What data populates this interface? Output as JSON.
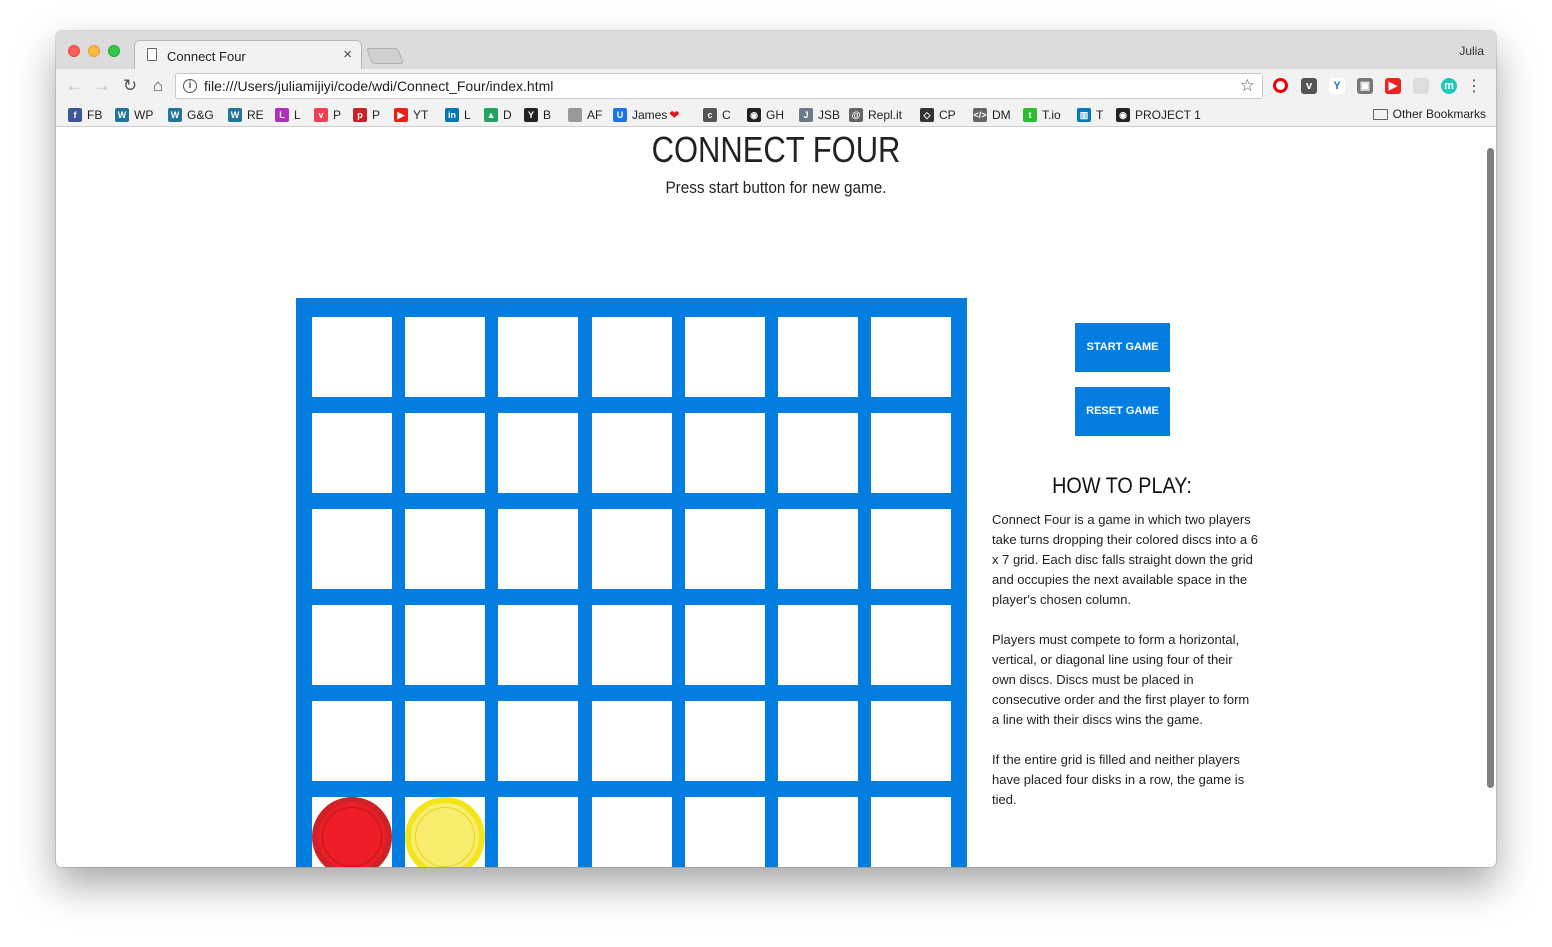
{
  "browser": {
    "tab_title": "Connect Four",
    "tab_close": "×",
    "profile_name": "Julia",
    "url": "file:///Users/juliamijiyi/code/wdi/Connect_Four/index.html",
    "nav": {
      "back": "←",
      "forward": "→",
      "reload": "↻",
      "home": "⌂"
    },
    "menu": "⋮",
    "star": "☆"
  },
  "bookmarks": [
    {
      "label": "FB",
      "icon": "facebook-icon",
      "color": "#3b5998",
      "glyph": "f"
    },
    {
      "label": "WP",
      "icon": "wordpress-icon",
      "color": "#21759b",
      "glyph": "W"
    },
    {
      "label": "G&G",
      "icon": "wordpress-icon",
      "color": "#21759b",
      "glyph": "W"
    },
    {
      "label": "RE",
      "icon": "wordpress-icon",
      "color": "#21759b",
      "glyph": "W"
    },
    {
      "label": "L",
      "icon": "lynda-icon",
      "color": "#b02fbf",
      "glyph": "L"
    },
    {
      "label": "P",
      "icon": "pocket-icon",
      "color": "#ef4056",
      "glyph": "v"
    },
    {
      "label": "P",
      "icon": "pinterest-icon",
      "color": "#cb2027",
      "glyph": "p"
    },
    {
      "label": "YT",
      "icon": "youtube-icon",
      "color": "#e62117",
      "glyph": "▶"
    },
    {
      "label": "L",
      "icon": "linkedin-icon",
      "color": "#0077b5",
      "glyph": "in"
    },
    {
      "label": "D",
      "icon": "drive-icon",
      "color": "#1fa463",
      "glyph": "▲"
    },
    {
      "label": "B",
      "icon": "bookmark-b-icon",
      "color": "#222222",
      "glyph": "Y"
    },
    {
      "label": "AF",
      "icon": "page-icon",
      "color": "#999999",
      "glyph": ""
    },
    {
      "label": "James",
      "icon": "udemy-icon",
      "color": "#1a73e8",
      "glyph": "U"
    },
    {
      "label": "C",
      "icon": "codecademy-icon",
      "color": "#555555",
      "glyph": "c"
    },
    {
      "label": "GH",
      "icon": "github-icon",
      "color": "#222222",
      "glyph": "◉"
    },
    {
      "label": "JSB",
      "icon": "jsbin-icon",
      "color": "#6c7a89",
      "glyph": "J"
    },
    {
      "label": "Repl.it",
      "icon": "replit-icon",
      "color": "#666666",
      "glyph": "@"
    },
    {
      "label": "CP",
      "icon": "codepen-icon",
      "color": "#333333",
      "glyph": "◇"
    },
    {
      "label": "DM",
      "icon": "code-icon",
      "color": "#666666",
      "glyph": "</>"
    },
    {
      "label": "T.io",
      "icon": "tio-icon",
      "color": "#2ebd2e",
      "glyph": "t"
    },
    {
      "label": "T",
      "icon": "trello-icon",
      "color": "#0079bf",
      "glyph": "▥"
    },
    {
      "label": "PROJECT 1",
      "icon": "github-icon",
      "color": "#222222",
      "glyph": "◉"
    }
  ],
  "bookmarks_other": "Other Bookmarks",
  "page": {
    "title": "CONNECT FOUR",
    "subtitle": "Press start button for new game.",
    "start_button": "START GAME",
    "reset_button": "RESET GAME",
    "howto_title": "HOW TO PLAY:",
    "howto_paragraphs": [
      "Connect Four is a game in which two players take turns dropping their colored discs into a 6 x 7 grid. Each disc falls straight down the grid and occupies the next available space in the player's chosen column.",
      "Players must compete to form a horizontal, vertical, or diagonal line using four of their own discs. Discs must be placed in consecutive order and the first player to form a line with their discs wins the game.",
      "If the entire grid is filled and neither players have placed four disks in a row, the game is tied."
    ]
  },
  "board": {
    "rows": 6,
    "cols": 7,
    "board_color": "#037ee0",
    "discs": [
      {
        "row": 5,
        "col": 0,
        "player": "red"
      },
      {
        "row": 5,
        "col": 1,
        "player": "yellow"
      }
    ]
  },
  "colors": {
    "accent": "#037ee0",
    "red_disc": "#ee1c26",
    "yellow_disc": "#f9ed6f"
  }
}
